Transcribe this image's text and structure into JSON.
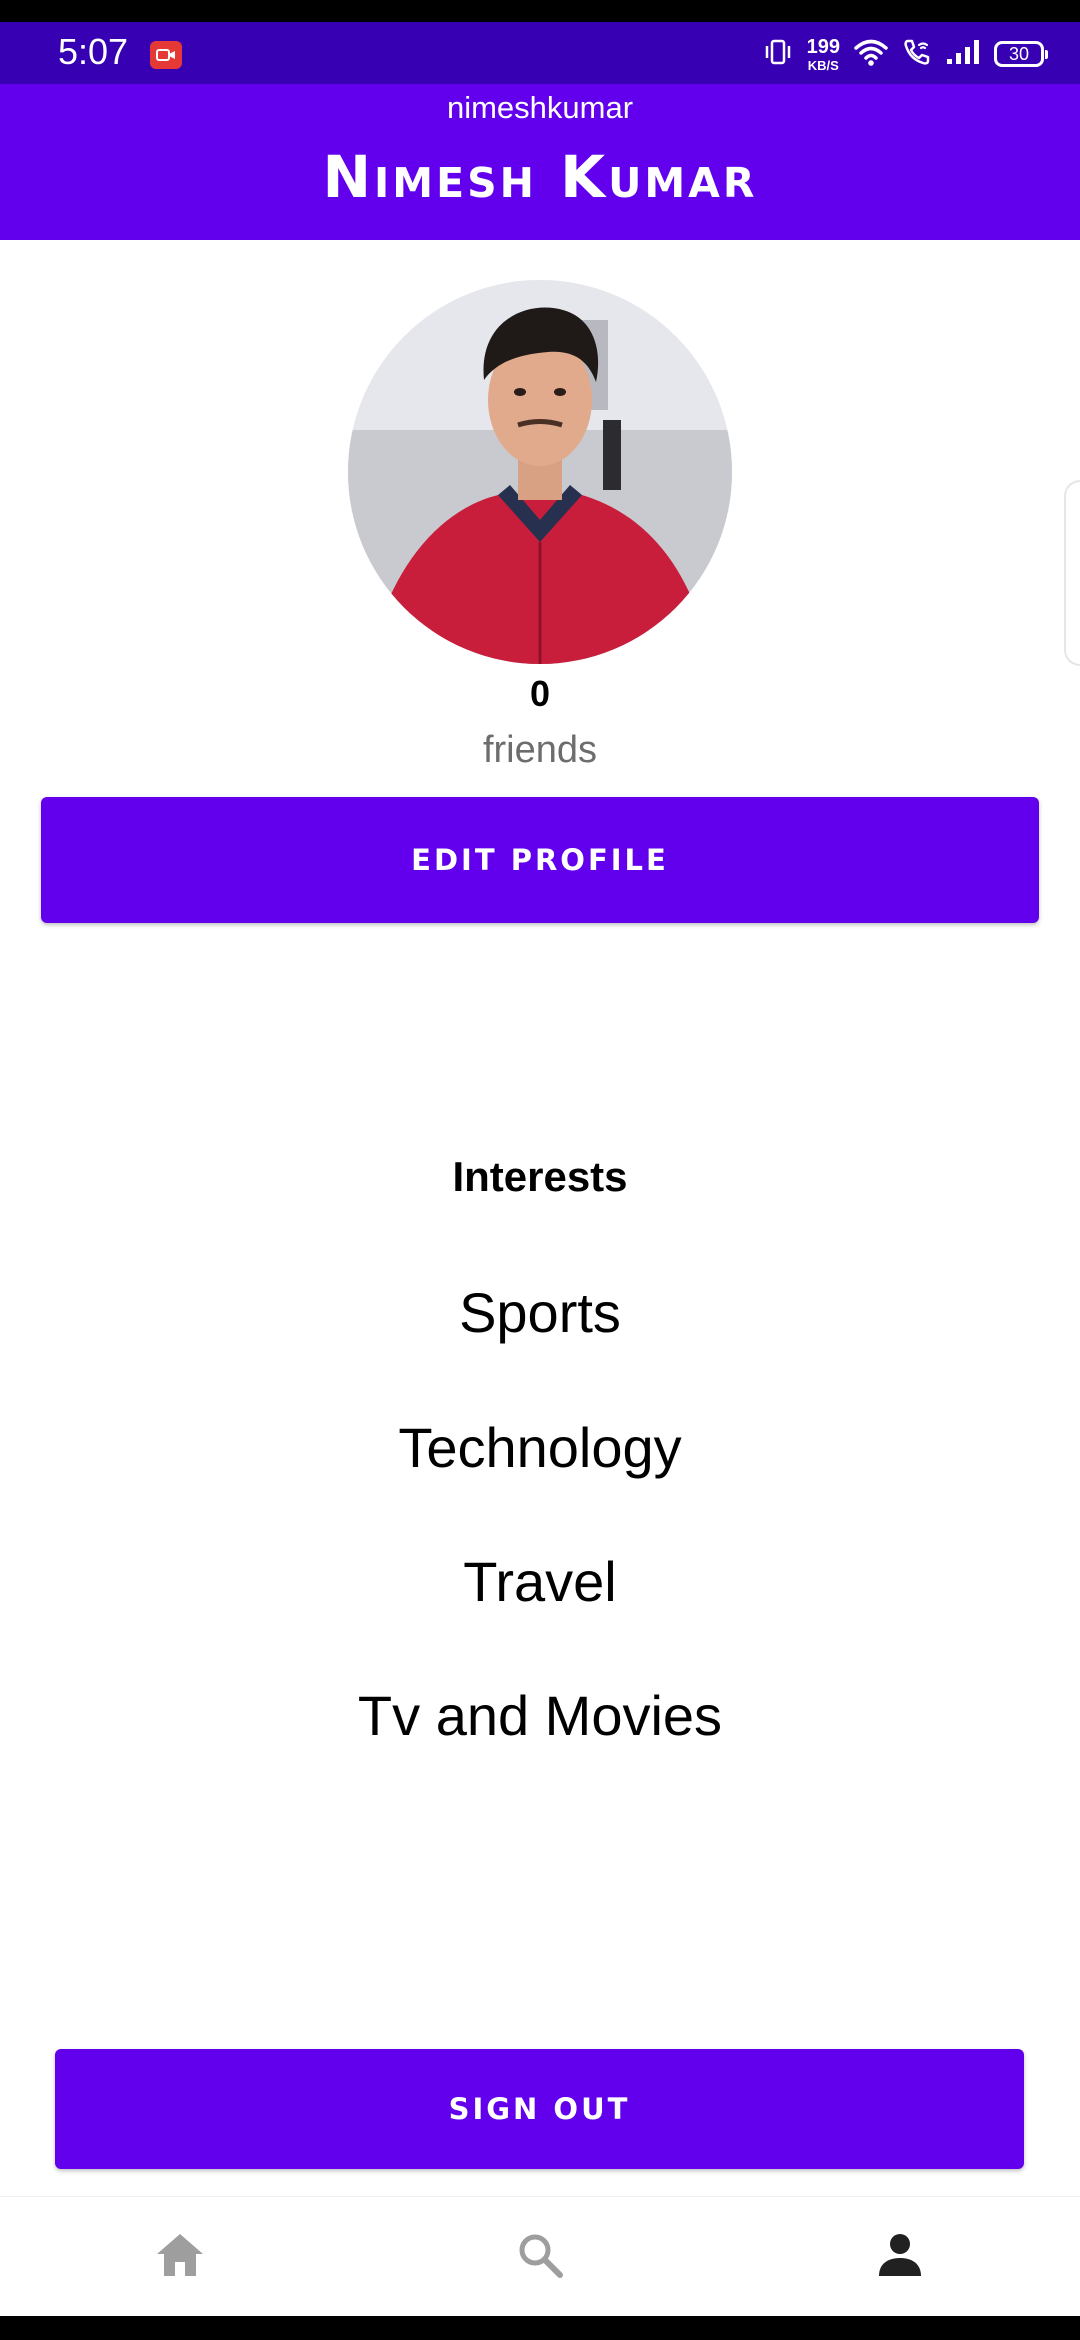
{
  "status_bar": {
    "time": "5:07",
    "net_speed_value": "199",
    "net_speed_unit": "KB/S",
    "battery": "30",
    "background_color": "#3700b3"
  },
  "header": {
    "username": "nimeshkumar",
    "display_name": "Nimesh Kumar",
    "background_color": "#6200ee"
  },
  "profile": {
    "friends_count": "0",
    "friends_label": "friends"
  },
  "buttons": {
    "edit_profile": "EDIT PROFILE",
    "sign_out": "SIGN OUT",
    "accent_color": "#6200ee"
  },
  "interests": {
    "title": "Interests",
    "items": [
      "Sports",
      "Technology",
      "Travel",
      "Tv and Movies"
    ]
  },
  "bottom_nav": {
    "items": [
      {
        "icon": "home-icon",
        "active": false
      },
      {
        "icon": "search-icon",
        "active": false
      },
      {
        "icon": "person-icon",
        "active": true
      }
    ],
    "inactive_color": "#9e9e9e",
    "active_color": "#212121"
  }
}
